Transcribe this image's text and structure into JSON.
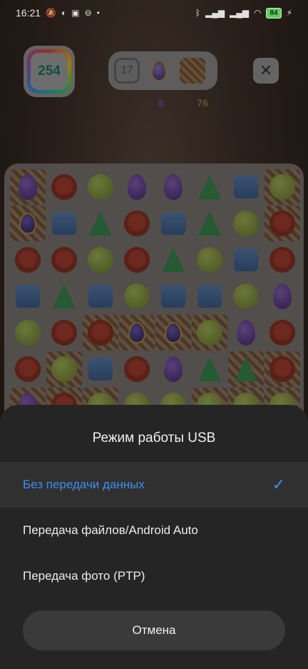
{
  "status_bar": {
    "time": "16:21",
    "battery": "84"
  },
  "game": {
    "score": "254",
    "moves": "17",
    "goal_egg_count": "8",
    "goal_crate_count": "76",
    "close_glyph": "✕",
    "board": [
      [
        "egg",
        "red",
        "lime",
        "egg",
        "egg",
        "tree",
        "blue",
        "lime"
      ],
      [
        "fegg",
        "blue",
        "tree",
        "red",
        "blue",
        "tree",
        "lime",
        "red"
      ],
      [
        "red",
        "red",
        "lime",
        "red",
        "tree",
        "lime",
        "blue",
        "red"
      ],
      [
        "blue",
        "tree",
        "blue",
        "lime",
        "blue",
        "blue",
        "lime",
        "egg"
      ],
      [
        "lime",
        "red",
        "red",
        "fegg",
        "fegg",
        "lime",
        "egg",
        "red"
      ],
      [
        "red",
        "lime",
        "blue",
        "red",
        "egg",
        "tree",
        "tree",
        "red"
      ],
      [
        "egg",
        "red",
        "lime",
        "lime",
        "lime",
        "lime",
        "lime",
        "lime"
      ]
    ],
    "crates": [
      [
        0,
        0
      ],
      [
        1,
        0
      ],
      [
        0,
        7
      ],
      [
        1,
        7
      ],
      [
        4,
        2
      ],
      [
        4,
        3
      ],
      [
        4,
        4
      ],
      [
        4,
        5
      ],
      [
        5,
        1
      ],
      [
        5,
        6
      ],
      [
        5,
        7
      ],
      [
        6,
        0
      ],
      [
        6,
        1
      ],
      [
        6,
        2
      ],
      [
        6,
        5
      ],
      [
        6,
        6
      ],
      [
        6,
        7
      ]
    ]
  },
  "sheet": {
    "title": "Режим работы USB",
    "options": [
      {
        "label": "Без передачи данных",
        "selected": true
      },
      {
        "label": "Передача файлов/Android Auto",
        "selected": false
      },
      {
        "label": "Передача фото (PTP)",
        "selected": false
      }
    ],
    "check_glyph": "✓",
    "cancel_label": "Отмена"
  },
  "colors": {
    "accent": "#3d8ef0",
    "sheet_bg": "#252525"
  }
}
